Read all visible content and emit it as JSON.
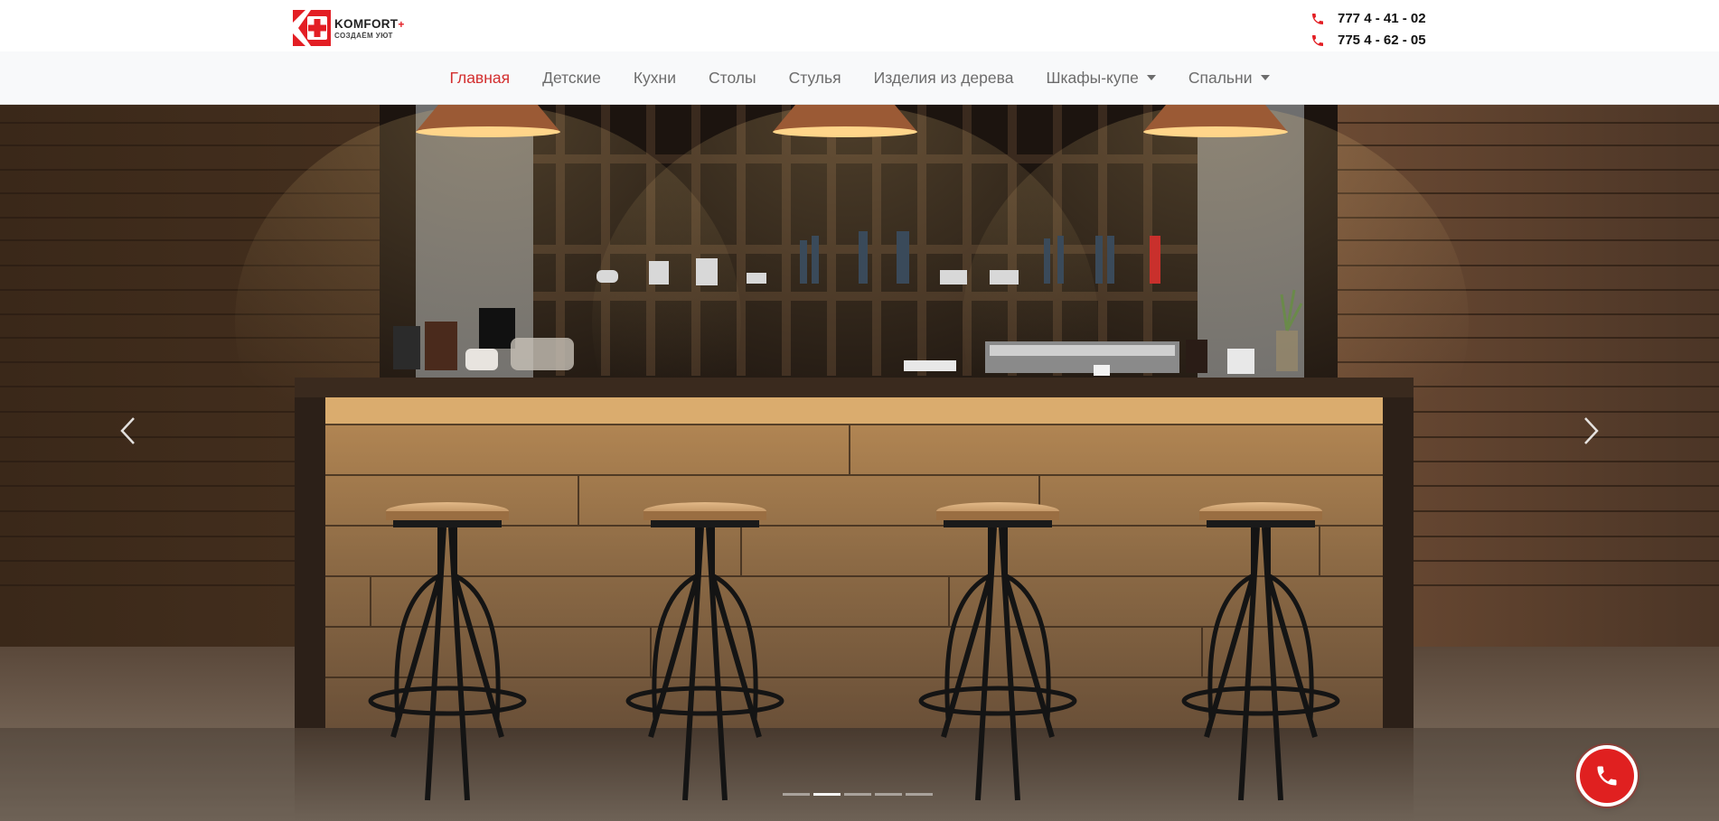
{
  "header": {
    "brand": {
      "name": "KOMFORT",
      "plus": "+",
      "tagline": "СОЗДАЁМ УЮТ"
    },
    "phones": [
      "777 4 - 41 - 02",
      "775 4 - 62 - 05"
    ]
  },
  "nav": {
    "items": [
      {
        "label": "Главная",
        "active": true
      },
      {
        "label": "Детские"
      },
      {
        "label": "Кухни"
      },
      {
        "label": "Столы"
      },
      {
        "label": "Стулья"
      },
      {
        "label": "Изделия из дерева"
      },
      {
        "label": "Шкафы-купе",
        "dropdown": true
      },
      {
        "label": "Спальни",
        "dropdown": true
      }
    ]
  },
  "carousel": {
    "slide_count": 5,
    "active_index": 1,
    "image": "bar-counter-with-stools"
  },
  "colors": {
    "accent": "#e31e24",
    "active_nav": "#d32f2f",
    "nav_text": "#6c6c6c",
    "call_button": "#e02020"
  },
  "icons": {
    "phone": "phone-icon",
    "prev": "chevron-left-icon",
    "next": "chevron-right-icon",
    "call": "phone-icon"
  }
}
